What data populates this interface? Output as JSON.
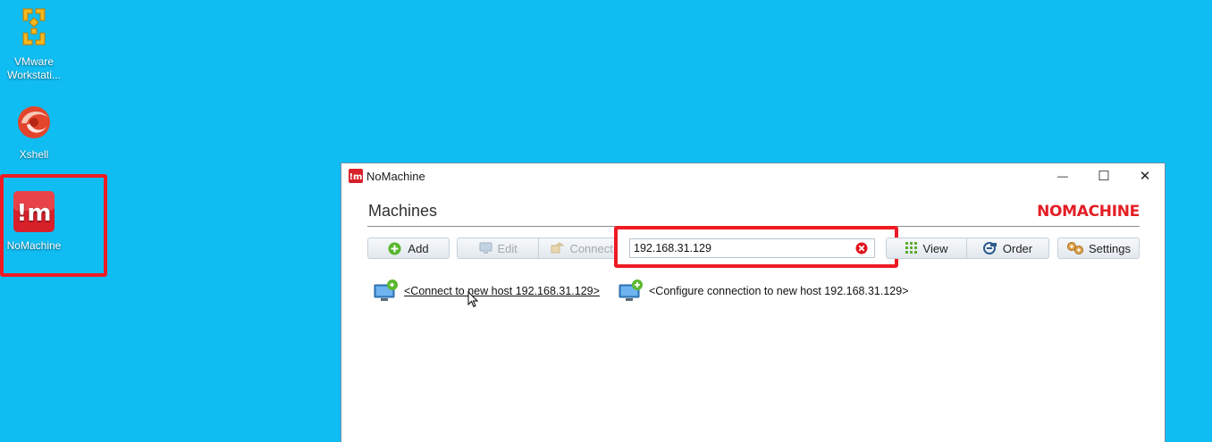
{
  "desktop": {
    "icons": [
      {
        "label": "VMware Workstati...",
        "icon": "vmware-icon"
      },
      {
        "label": "Xshell",
        "icon": "xshell-icon"
      },
      {
        "label": "NoMachine",
        "icon": "nomachine-icon"
      }
    ]
  },
  "window": {
    "title": "NoMachine",
    "controls": {
      "minimize": "—",
      "maximize": "☐",
      "close": "✕"
    },
    "heading": "Machines",
    "brand": "NOMACHINE",
    "toolbar": {
      "add_label": "Add",
      "edit_label": "Edit",
      "connect_label": "Connect",
      "view_label": "View",
      "order_label": "Order",
      "settings_label": "Settings"
    },
    "search": {
      "value": "192.168.31.129",
      "placeholder": ""
    },
    "results": [
      {
        "label": "<Connect to new host 192.168.31.129>",
        "icon": "connect-new-host-icon"
      },
      {
        "label": "<Configure connection to new host 192.168.31.129>",
        "icon": "configure-new-host-icon"
      }
    ]
  },
  "colors": {
    "desktop_bg": "#10bdf2",
    "highlight": "#ee1b24",
    "brand": "#e31e25"
  }
}
